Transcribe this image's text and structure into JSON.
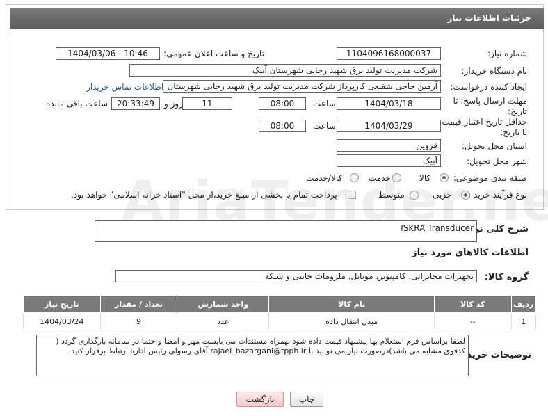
{
  "header": {
    "title": "جزئیات اطلاعات نیاز"
  },
  "fields": {
    "need_number_label": "شماره نیاز:",
    "need_number": "1104096168000037",
    "announce_label": "تاریخ و ساعت اعلان عمومی:",
    "announce_value": "1404/03/06 - 10:46",
    "buyer_label": "نام دستگاه خریدار:",
    "buyer_value": "شرکت مدیریت تولید برق شهید رجایی شهرستان آبیک",
    "creator_label": "ایجاد کننده درخواست:",
    "creator_value": "آرمین حاجی شفیعی کارپرداز شرکت مدیریت تولید برق شهید رجایی شهرستان",
    "contact_link": "اطلاعات تماس خریدار",
    "deadline_label_1": "مهلت ارسال پاسخ: تا",
    "deadline_label_2": "تاریخ:",
    "deadline_date": "1404/03/18",
    "hour_label": "ساعت",
    "deadline_time": "08:00",
    "days_value": "11",
    "days_label": "روز و",
    "remaining_time": "20:33:49",
    "remaining_label": "ساعت باقی مانده",
    "price_label_1": "حداقل تاریخ اعتبار قیمت:",
    "price_label_2": "تا تاریخ:",
    "price_date": "1404/03/29",
    "price_hour_label": "ساعت",
    "price_time": "08:00",
    "province_label": "استان محل تحویل:",
    "province_value": "قزوین",
    "city_label": "شهر محل تحویل:",
    "city_value": "آبیک",
    "category_label": "طبقه بندی موضوعی:",
    "category_options": [
      "کالا",
      "خدمت",
      "کالا/خدمت"
    ],
    "process_label": "نوع فرآیند خرید :",
    "process_options": [
      "جزیی",
      "متوسط"
    ],
    "process_note": "پرداخت تمام یا بخشی از مبلغ خرید،از محل \"اسناد خزانه اسلامی\" خواهد بود."
  },
  "summary": {
    "label": "شرح کلی نیاز:",
    "value": "ISKRA Transducer",
    "goods_info_title": "اطلاعات کالاهای مورد نیاز",
    "goods_group_label": "گروه کالا:",
    "goods_group_value": "تجهیزات مخابراتی، کامپیوتر، موبایل، ملزومات جانبی و شبکه"
  },
  "table": {
    "headers": [
      "ردیف",
      "کد کالا",
      "نام کالا",
      "واحد شمارش",
      "تعداد / مقدار",
      "تاریخ نیاز"
    ],
    "rows": [
      [
        "1",
        "--",
        "مبدل انتقال داده",
        "عدد",
        "9",
        "1404/03/24"
      ]
    ]
  },
  "notes": {
    "label": "توضیحات خریدار:",
    "text": "لطفا براساس فرم استعلام بها پیشنهاد قیمت داده شود بهمراه مستندات می بایست مهر و امضا و حتما در سامانه بارگذاری گردد ( کدفوق مشابه می باشد)درصورت نیاز می توانید با rajaei_bazargani@tpph.ir آقای رسولی رئیس  اداره ارتباط برقرار کنید"
  },
  "buttons": {
    "print": "چاپ",
    "back": "بازگشت"
  },
  "watermark": "AriaTender.neT"
}
